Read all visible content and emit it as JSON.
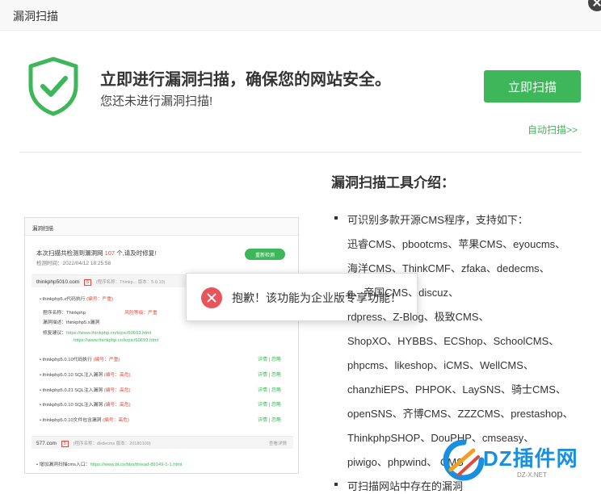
{
  "window": {
    "title": "漏洞扫描"
  },
  "hero": {
    "headline": "立即进行漏洞扫描，确保您的网站安全。",
    "subline": "您还未进行漏洞扫描!",
    "scan_button": "立即扫描",
    "auto_scan_link": "自动扫描>>",
    "accent_color": "#3eb65a"
  },
  "preview": {
    "header": "漏洞扫描",
    "summary_prefix": "本次扫描共检测到漏洞网",
    "summary_count": "107",
    "summary_suffix": "个,请及时修复!",
    "time": "检测时间：2022/04/12 18:25:58",
    "recheck": "重新检测",
    "site1": {
      "name": "thinkphp5010.com",
      "count": "5",
      "meta": "(程序名称：Thinkp...  版本：5.0.10)"
    },
    "site1_items": [
      {
        "text": "thinkphp5.x代码执行",
        "tag": "(编号：严重)"
      },
      {
        "text": "程序名称：Thinkphp",
        "tag": "风险等级：严重"
      },
      {
        "text": "漏洞描述：thinkphp5.x漏洞",
        "tag": ""
      },
      {
        "text": "修复建议：",
        "link": "https://www.thinkphp.cn/topic/60693.html"
      },
      {
        "text": "",
        "link": "https://www.thinkphp.cn/topic/60693.html"
      },
      {
        "text": "thinkphp5.0.10代码执行",
        "tag": "(编号：严重)",
        "actions": "详情 | 忽略"
      },
      {
        "text": "thinkphp5.0.10 SQL注入漏洞",
        "tag": "(编号：高危)",
        "actions": "详情 | 忽略"
      },
      {
        "text": "thinkphp5.0.21 SQL注入漏洞",
        "tag": "(编号：高危)",
        "actions": "详情 | 忽略"
      },
      {
        "text": "thinkphp5.0.10 SQL注入漏洞",
        "tag": "(编号：高危)",
        "actions": "详情 | 忽略"
      },
      {
        "text": "thinkphp5.0.10文件包含漏洞",
        "tag": "(编号：高危)",
        "actions": "详情 | 忽略"
      }
    ],
    "site2": {
      "name": "577.com",
      "count": "5",
      "meta": "(程序名称：dedecms  版本：20180109)",
      "toggle": "查看详情"
    },
    "footer_prefix": "增加漏洞扫描cms入口：",
    "footer_link": "https://www.bt.cn/bbs/thread-89149-1-1.html"
  },
  "modal": {
    "message": "抱歉！该功能为企业版专享功能！"
  },
  "intro": {
    "title": "漏洞扫描工具介绍：",
    "feature1": "可识别多款开源CMS程序，支持如下：",
    "cms_lines": [
      "迅睿CMS、pbootcms、苹果CMS、eyoucms、",
      "海洋CMS、ThinkCMF、zfaka、dedecms、",
      "                           g、帝国CMS、discuz、",
      "                        rdpress、Z-Blog、极致CMS、",
      "ShopXO、HYBBS、ECShop、SchoolCMS、",
      "phpcms、likeshop、iCMS、WellCMS、",
      "chanzhiEPS、PHPOK、LaySNS、骑士CMS、",
      "openSNS、齐博CMS、ZZZCMS、prestashop、",
      "ThinkphpSHOP、DouPHP、cmseasy、",
      "piwigo、phpwind、           CMS"
    ],
    "feature2": "可扫描网站中存在的漏洞"
  },
  "watermark": {
    "brand": "DZ插件网",
    "sub": "DZ-X.NET"
  }
}
